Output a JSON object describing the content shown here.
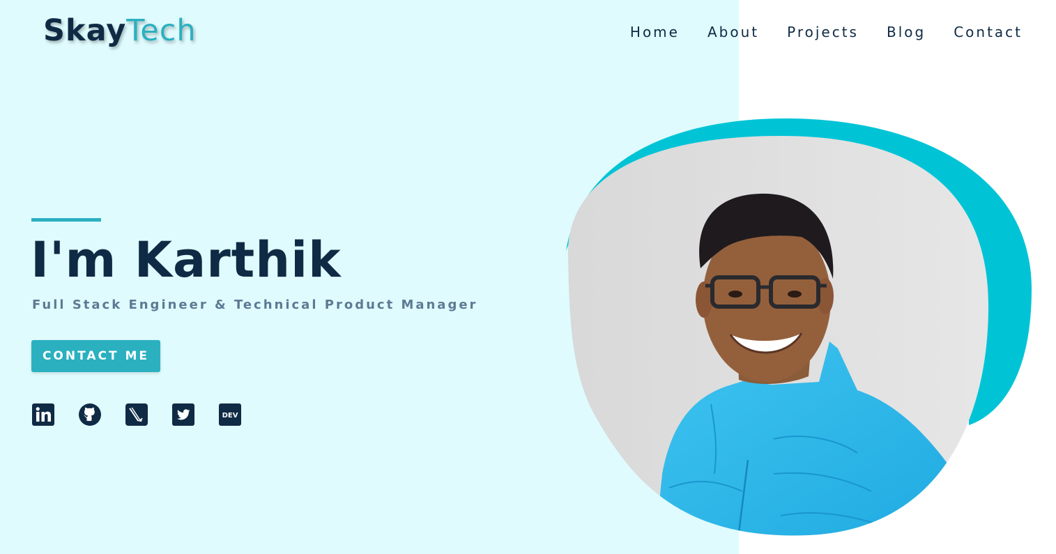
{
  "logo": {
    "part1": "Skay",
    "part2": "Tech"
  },
  "nav": {
    "items": [
      {
        "label": "Home"
      },
      {
        "label": "About"
      },
      {
        "label": "Projects"
      },
      {
        "label": "Blog"
      },
      {
        "label": "Contact"
      }
    ]
  },
  "hero": {
    "title": "I'm Karthik",
    "subtitle": "Full Stack Engineer & Technical Product Manager",
    "button_label": "CONTACT ME"
  },
  "socials": {
    "icons": [
      "linkedin-icon",
      "github-icon",
      "hashnode-icon",
      "twitter-icon",
      "dev-icon"
    ],
    "dev_label": "DEV"
  },
  "colors": {
    "navy": "#0f2a44",
    "accent": "#2bb0c0",
    "panel_bg": "#dffbfd",
    "blob": "#00c4d6",
    "subtitle": "#5d7a94"
  }
}
